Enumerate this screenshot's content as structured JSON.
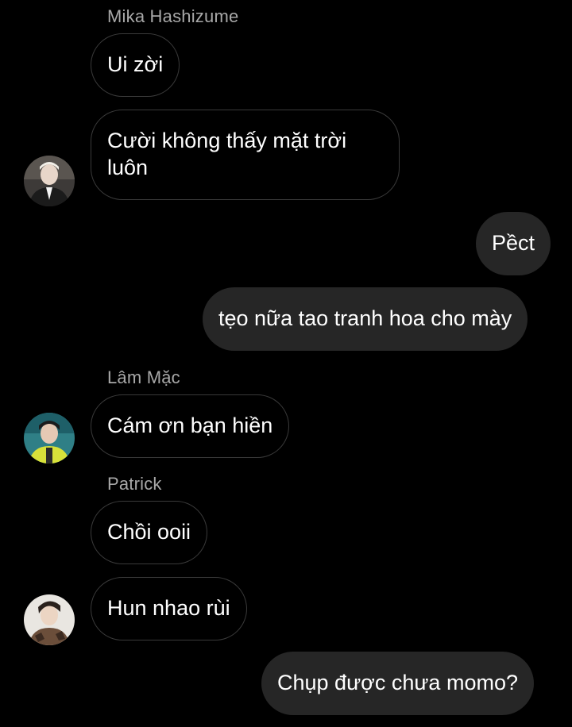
{
  "colors": {
    "background": "#000000",
    "incoming_border": "#3a3a3a",
    "outgoing_bubble": "#262626",
    "sender_name": "#a8a8a8",
    "text": "#ffffff"
  },
  "messages": [
    {
      "sender": "Mika Hashizume",
      "text": "Ui zời"
    },
    {
      "text": "Cười không thấy mặt trời luôn",
      "avatar": "avatar-mika-hashizume"
    },
    {
      "text": "Pềct",
      "outgoing": true
    },
    {
      "text": "tẹo nữa tao tranh hoa cho mày",
      "outgoing": true
    },
    {
      "sender": "Lâm Mặc",
      "text": "Cám ơn bạn hiền",
      "avatar": "avatar-lam-mac"
    },
    {
      "sender": "Patrick",
      "text": "Chồi ooii"
    },
    {
      "text": "Hun nhao rùi",
      "avatar": "avatar-patrick"
    },
    {
      "text": "Chụp được chưa momo?",
      "outgoing": true
    }
  ]
}
